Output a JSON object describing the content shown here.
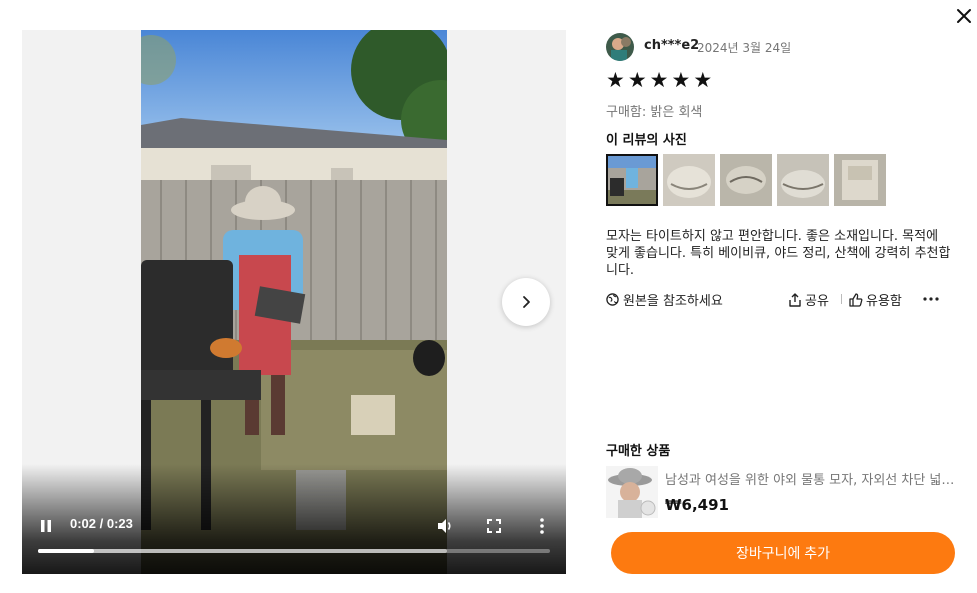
{
  "dialog": {
    "close_icon": "close-icon"
  },
  "video": {
    "time_current": "0:02",
    "time_total": "0:23",
    "progress": 0.109,
    "buffered": 0.799,
    "state": "playing"
  },
  "review": {
    "user": "ch***e2",
    "date": "2024년 3월 24일",
    "rating": 5,
    "purchased_variant": "구매함: 밝은 회색",
    "photos_heading": "이 리뷰의 사진",
    "photos": [
      "photo-1",
      "photo-2",
      "photo-3",
      "photo-4",
      "photo-5"
    ],
    "text": "모자는 타이트하지 않고 편안합니다. 좋은 소재입니다. 목적에 맞게 좋습니다. 특히 베이비큐, 야드 정리, 산책에 강력히 추천합니다.",
    "see_original": "원본을 참조하세요",
    "share": "공유",
    "helpful": "유용함"
  },
  "product": {
    "heading": "구매한 상품",
    "title": "남성과 여성을 위한 야외 물통 모자, 자외선 차단 넓은 챙 낚시 모자",
    "price": "₩6,491"
  },
  "cart": {
    "label": "장바구니에 추가"
  },
  "colors": {
    "accent": "#fd7a10"
  }
}
